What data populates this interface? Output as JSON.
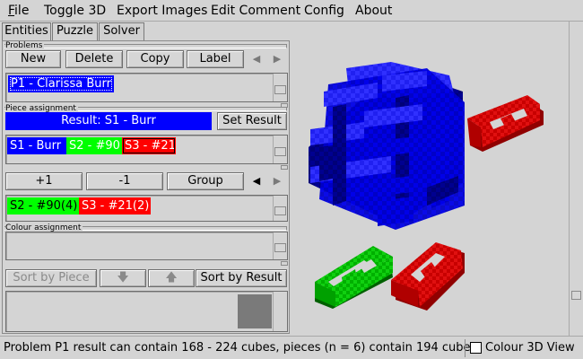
{
  "menu": [
    "File",
    "Toggle 3D",
    "Export Images",
    "Edit Comment",
    "Config",
    "About"
  ],
  "tabs": [
    "Entities",
    "Puzzle",
    "Solver"
  ],
  "active_tab": "Puzzle",
  "problems": {
    "section_label": "Problems",
    "buttons": {
      "new": "New",
      "delete": "Delete",
      "copy": "Copy",
      "label": "Label"
    },
    "list": [
      "P1 - Clarissa Burr"
    ]
  },
  "piece_assignment": {
    "section_label": "Piece assignment",
    "result_label": "Result: S1 - Burr",
    "set_result_button": "Set Result",
    "shapes": [
      {
        "label": "S1 - Burr",
        "color": "#0000ff",
        "text_color": "#ffffff"
      },
      {
        "label": "S2 - #90",
        "color": "#00ff00",
        "text_color": "#ffffff"
      },
      {
        "label": "S3 - #21",
        "color": "#ff0000",
        "text_color": "#ffffff"
      }
    ],
    "buttons": {
      "plus": "+1",
      "minus": "-1",
      "group": "Group"
    },
    "assigned": [
      {
        "label": "S2 - #90(4)",
        "color": "#00ff00",
        "text_color": "#000000"
      },
      {
        "label": "S3 - #21(2)",
        "color": "#ff0000",
        "text_color": "#ffffff"
      }
    ]
  },
  "colour_assignment": {
    "section_label": "Colour assignment",
    "buttons": {
      "sort_by_piece": "Sort by Piece",
      "sort_by_result": "Sort by Result"
    }
  },
  "status": {
    "text": "Problem P1 result can contain 168 - 224 cubes, pieces (n = 6) contain 194 cubes",
    "colour_3d_label": "Colour 3D View",
    "colour_3d_checked": false
  },
  "colors": {
    "blue": "#0000ff",
    "green": "#00cc00",
    "red": "#ff0000",
    "selected": "#0000ff"
  }
}
